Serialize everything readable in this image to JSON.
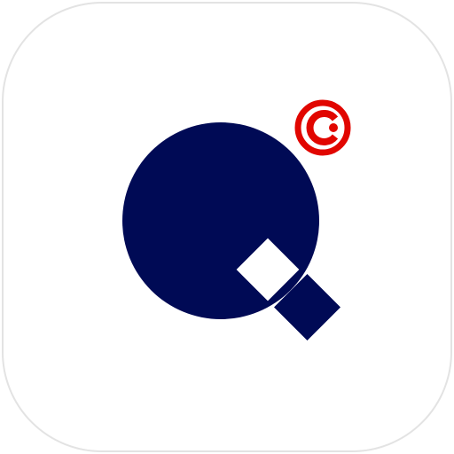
{
  "app_icon": {
    "symbol": "q-logo-icon",
    "badge": "red-c-badge-icon",
    "colors": {
      "background": "#ffffff",
      "border": "#e3e3e3",
      "navy": "#000a55",
      "badge_red": "#e10600",
      "white": "#ffffff"
    }
  }
}
